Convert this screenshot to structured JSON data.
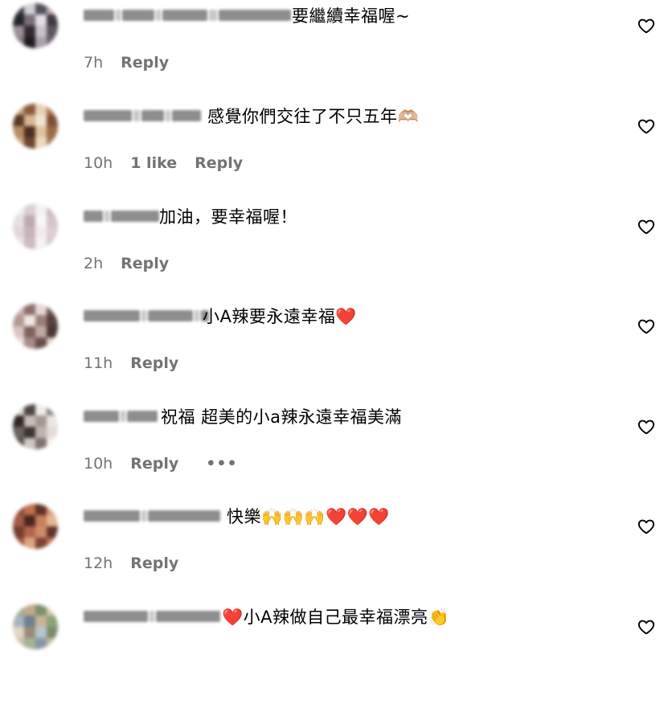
{
  "colors": {
    "secondary_text": "#737373",
    "primary_text": "#000000",
    "background": "#ffffff"
  },
  "comments": [
    {
      "username": "",
      "text": "要繼續幸福喔~",
      "timestamp": "7h",
      "likes": "",
      "reply_label": "Reply",
      "has_more": false,
      "avatar_palette": [
        "#3b3b44",
        "#cfcfd6",
        "#55505a",
        "#b9a9a9",
        "#24242c",
        "#7a6f77",
        "#e1dee3",
        "#403a44",
        "#9d8f97",
        "#2f2a31",
        "#c9c3c8",
        "#5e5560",
        "#877b84",
        "#1f1c22",
        "#aaa2a8",
        "#6b636c"
      ]
    },
    {
      "username": "",
      "text": "感覺你們交往了不只五年🫶🏼",
      "timestamp": "10h",
      "likes": "1 like",
      "reply_label": "Reply",
      "has_more": false,
      "avatar_palette": [
        "#c79e7b",
        "#8b5a3c",
        "#e8d1b8",
        "#a9774f",
        "#5a3a27",
        "#d7b694",
        "#f1e3d1",
        "#7c5038",
        "#b88b64",
        "#4b2f21",
        "#e0c2a0",
        "#9a6a48",
        "#c9a17f",
        "#6e4530",
        "#efd9bf",
        "#a57b58"
      ]
    },
    {
      "username": "",
      "text": "加油，要幸福喔！",
      "timestamp": "2h",
      "likes": "",
      "reply_label": "Reply",
      "has_more": false,
      "avatar_palette": [
        "#eeeeee",
        "#d9cfd3",
        "#f4f1f2",
        "#c9b8bf",
        "#e7dfe3",
        "#bfa7b0",
        "#f8f6f7",
        "#d3c3ca",
        "#e2d6db",
        "#c7b2ba",
        "#f0ebed",
        "#dccdd3",
        "#ebe4e7",
        "#cdbac2",
        "#f5f2f3",
        "#d6c7cd"
      ]
    },
    {
      "username": "",
      "text": "小A辣要永遠幸福❤️",
      "timestamp": "11h",
      "likes": "",
      "reply_label": "Reply",
      "has_more": false,
      "avatar_palette": [
        "#c8b3ad",
        "#8d6f6a",
        "#e5d8d4",
        "#6f5350",
        "#b39892",
        "#f0e7e4",
        "#9d7f79",
        "#57403d",
        "#d8c5c0",
        "#7e625e",
        "#c2aaa4",
        "#4b3633",
        "#e9ddd9",
        "#a88c86",
        "#6a4f4b",
        "#dccbc6"
      ]
    },
    {
      "username": "",
      "text": "祝福 超美的小a辣永遠幸福美滿",
      "timestamp": "10h",
      "likes": "",
      "reply_label": "Reply",
      "has_more": true,
      "more_label": "•••",
      "avatar_palette": [
        "#d9d6d4",
        "#4d4643",
        "#f0ece9",
        "#8f8581",
        "#2e2926",
        "#c8bfba",
        "#a39893",
        "#ece6e2",
        "#6b625e",
        "#3d3633",
        "#bdb3ae",
        "#e3dcd8",
        "#58504c",
        "#d0c7c2",
        "#7e7470",
        "#f5f1ee"
      ]
    },
    {
      "username": "",
      "text": "快樂🙌🙌🙌❤️❤️❤️",
      "timestamp": "12h",
      "likes": "",
      "reply_label": "Reply",
      "has_more": false,
      "avatar_palette": [
        "#8a4a3a",
        "#c0704f",
        "#5e3127",
        "#d89a78",
        "#a35b45",
        "#4a251e",
        "#c97e5c",
        "#e5b596",
        "#743d30",
        "#b2664b",
        "#d08c6a",
        "#63342a",
        "#9c5441",
        "#dda585",
        "#7f4435",
        "#be7555"
      ]
    },
    {
      "username": "",
      "text": "❤️小A辣做自己最幸福漂亮👏",
      "timestamp": "",
      "likes": "",
      "reply_label": "",
      "has_more": false,
      "avatar_palette": [
        "#9fb08c",
        "#c3a98e",
        "#7d8f6b",
        "#d8c6b1",
        "#a8b3c2",
        "#6f7f8f",
        "#c9b497",
        "#8da27a",
        "#e2d5c3",
        "#9a8b78",
        "#b7c4cf",
        "#7b8c6a",
        "#d1bfa6",
        "#a4b594",
        "#8796a6",
        "#c8b9a5"
      ]
    }
  ]
}
